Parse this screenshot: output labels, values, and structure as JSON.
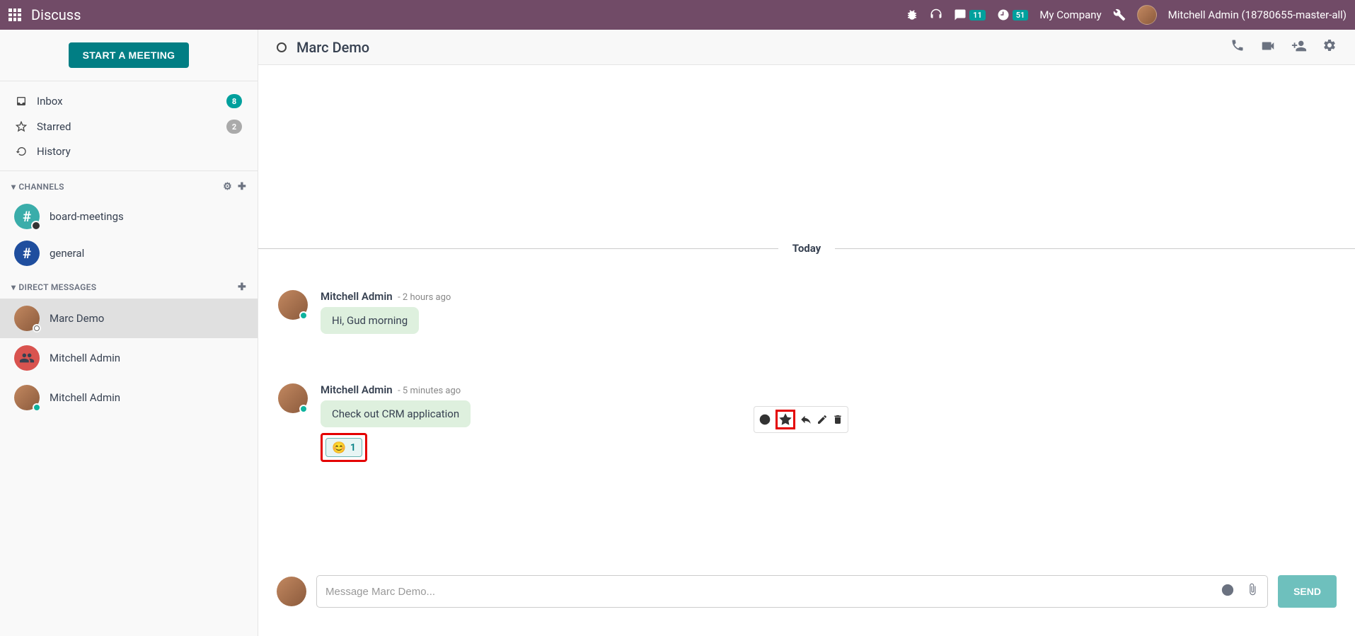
{
  "navbar": {
    "title": "Discuss",
    "messages_badge": "11",
    "activities_badge": "51",
    "company": "My Company",
    "user": "Mitchell Admin (18780655-master-all)"
  },
  "sidebar": {
    "start_meeting": "START A MEETING",
    "mailboxes": [
      {
        "label": "Inbox",
        "count": "8",
        "counter_class": ""
      },
      {
        "label": "Starred",
        "count": "2",
        "counter_class": "gray"
      },
      {
        "label": "History",
        "count": "",
        "counter_class": ""
      }
    ],
    "channels_header": "CHANNELS",
    "channels": [
      {
        "name": "board-meetings",
        "color": "green"
      },
      {
        "name": "general",
        "color": "blue"
      }
    ],
    "dm_header": "DIRECT MESSAGES",
    "dms": [
      {
        "name": "Marc Demo",
        "active": true,
        "avatar": "photo",
        "status": "offline"
      },
      {
        "name": "Mitchell Admin",
        "active": false,
        "avatar": "red",
        "status": "none"
      },
      {
        "name": "Mitchell Admin",
        "active": false,
        "avatar": "photo",
        "status": "online"
      }
    ]
  },
  "thread": {
    "header_name": "Marc Demo",
    "date_separator": "Today",
    "messages": [
      {
        "author": "Mitchell Admin",
        "time": "- 2 hours ago",
        "content": "Hi, Gud morning"
      },
      {
        "author": "Mitchell Admin",
        "time": "- 5 minutes ago",
        "content": "Check out CRM application"
      }
    ],
    "reaction": {
      "emoji": "😊",
      "count": "1"
    }
  },
  "composer": {
    "placeholder": "Message Marc Demo...",
    "send": "SEND"
  }
}
